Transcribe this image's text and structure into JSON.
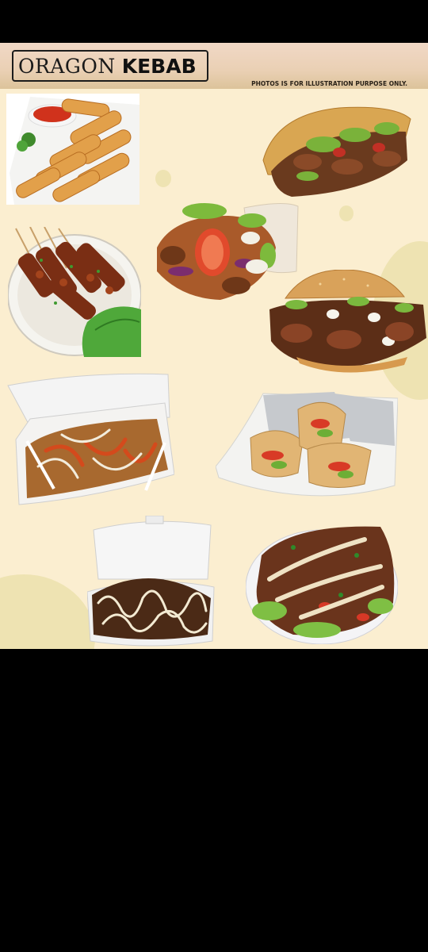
{
  "brand": {
    "word1": "ORAGON",
    "word2": "KEBAB"
  },
  "disclaimer": "PHOTOS IS FOR ILLUSTRATION PURPOSE ONLY.",
  "colors": {
    "background": "#000000",
    "poster": "#fbeed0",
    "header": "#ead0b4",
    "text": "#1a1a1a"
  },
  "photos": [
    {
      "name": "spring-rolls"
    },
    {
      "name": "kebab-pita"
    },
    {
      "name": "kebab-wrap-open"
    },
    {
      "name": "chicken-skewers"
    },
    {
      "name": "kebab-burger"
    },
    {
      "name": "kebab-fries-box"
    },
    {
      "name": "foil-wraps"
    },
    {
      "name": "kebab-box"
    },
    {
      "name": "kebab-plate"
    }
  ]
}
